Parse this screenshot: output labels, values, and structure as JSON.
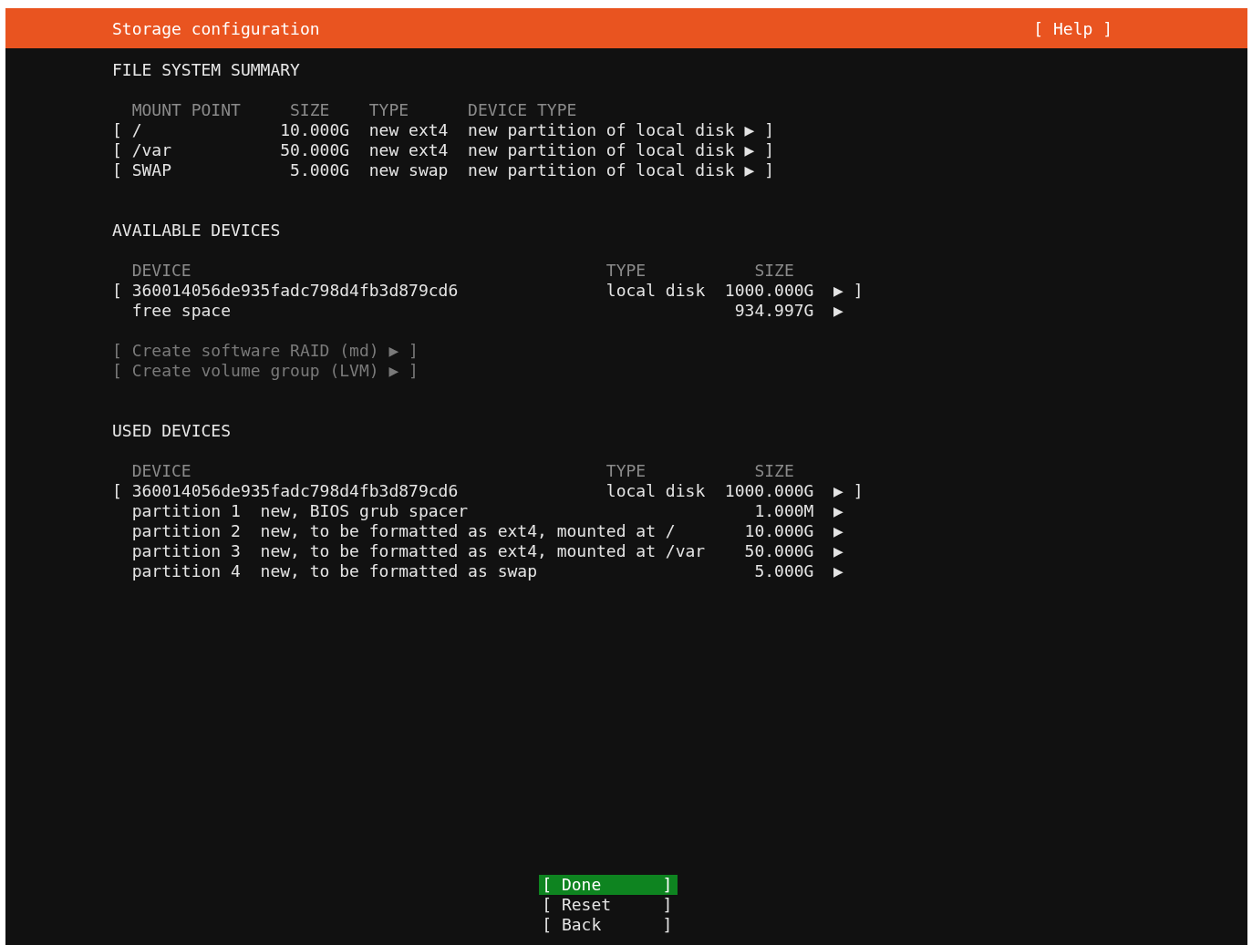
{
  "header": {
    "title": "Storage configuration",
    "help": "[ Help ]"
  },
  "file_system_summary": {
    "heading": "FILE SYSTEM SUMMARY",
    "columns": [
      "MOUNT POINT",
      "SIZE",
      "TYPE",
      "DEVICE TYPE"
    ],
    "rows": [
      {
        "open": "[",
        "mount_point": "/",
        "size": "10.000G",
        "type": "new ext4",
        "device_type": "new partition of local disk",
        "arrow": "▶",
        "close": "]"
      },
      {
        "open": "[",
        "mount_point": "/var",
        "size": "50.000G",
        "type": "new ext4",
        "device_type": "new partition of local disk",
        "arrow": "▶",
        "close": "]"
      },
      {
        "open": "[",
        "mount_point": "SWAP",
        "size": "5.000G",
        "type": "new swap",
        "device_type": "new partition of local disk",
        "arrow": "▶",
        "close": "]"
      }
    ]
  },
  "available_devices": {
    "heading": "AVAILABLE DEVICES",
    "columns": [
      "DEVICE",
      "TYPE",
      "SIZE"
    ],
    "rows": [
      {
        "kind": "disk",
        "open": "[",
        "device": "360014056de935fadc798d4fb3d879cd6",
        "type": "local disk",
        "size": "1000.000G",
        "arrow": "▶",
        "close": "]"
      },
      {
        "kind": "free",
        "device": "free space",
        "size": "934.997G",
        "arrow": "▶"
      }
    ],
    "actions": [
      {
        "open": "[",
        "label": "Create software RAID (md)",
        "arrow": "▶",
        "close": "]",
        "disabled": true
      },
      {
        "open": "[",
        "label": "Create volume group (LVM)",
        "arrow": "▶",
        "close": "]",
        "disabled": true
      }
    ]
  },
  "used_devices": {
    "heading": "USED DEVICES",
    "columns": [
      "DEVICE",
      "TYPE",
      "SIZE"
    ],
    "rows": [
      {
        "kind": "disk",
        "open": "[",
        "device": "360014056de935fadc798d4fb3d879cd6",
        "type": "local disk",
        "size": "1000.000G",
        "arrow": "▶",
        "close": "]"
      },
      {
        "kind": "partition",
        "device": "partition 1",
        "description": "new, BIOS grub spacer",
        "size": "1.000M",
        "arrow": "▶"
      },
      {
        "kind": "partition",
        "device": "partition 2",
        "description": "new, to be formatted as ext4, mounted at /",
        "size": "10.000G",
        "arrow": "▶"
      },
      {
        "kind": "partition",
        "device": "partition 3",
        "description": "new, to be formatted as ext4, mounted at /var",
        "size": "50.000G",
        "arrow": "▶"
      },
      {
        "kind": "partition",
        "device": "partition 4",
        "description": "new, to be formatted as swap",
        "size": "5.000G",
        "arrow": "▶"
      }
    ]
  },
  "buttons": [
    {
      "open": "[",
      "label": "Done",
      "close": "]",
      "selected": true
    },
    {
      "open": "[",
      "label": "Reset",
      "close": "]",
      "selected": false
    },
    {
      "open": "[",
      "label": "Back",
      "close": "]",
      "selected": false
    }
  ]
}
